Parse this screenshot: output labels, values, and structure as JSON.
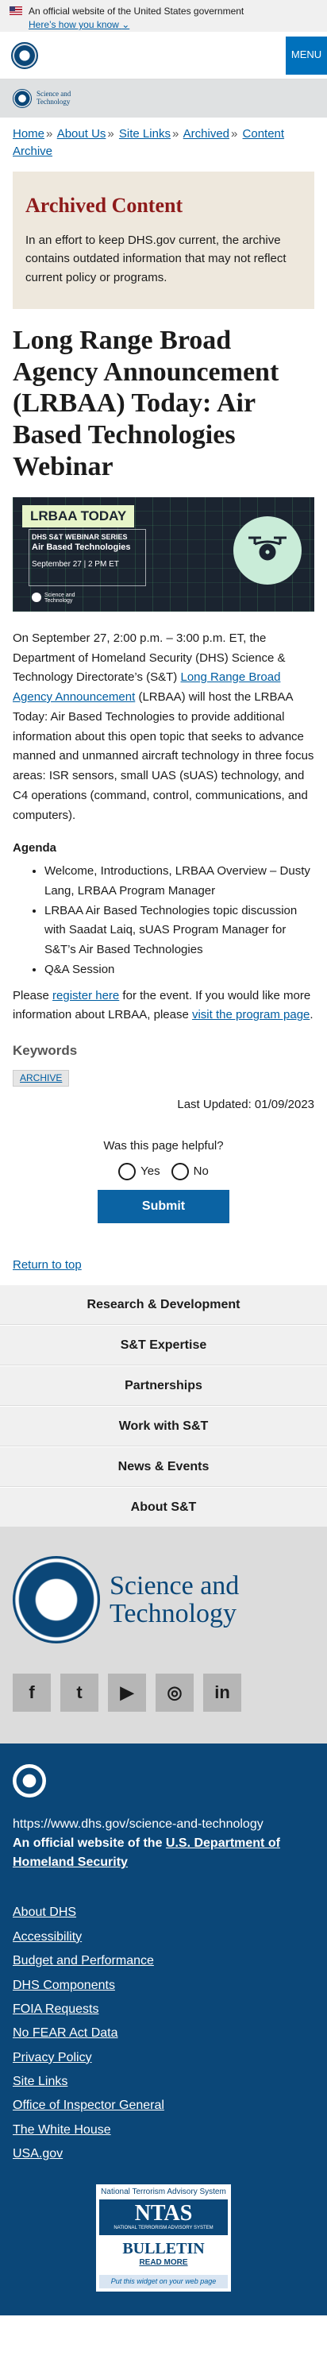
{
  "gov_banner": {
    "text": "An official website of the United States government",
    "how": "Here’s how you know"
  },
  "header": {
    "menu": "MENU"
  },
  "st_bar": {
    "line1": "Science and",
    "line2": "Technology"
  },
  "breadcrumb": [
    "Home",
    "About Us",
    "Site Links",
    "Archived",
    "Content Archive"
  ],
  "archived": {
    "title": "Archived Content",
    "text": "In an effort to keep DHS.gov current, the archive contains outdated information that may not reflect current policy or programs."
  },
  "title": "Long Range Broad Agency Announcement (LRBAA) Today: Air Based Technologies Webinar",
  "hero": {
    "tag": "LRBAA TODAY",
    "series": "DHS S&T WEBINAR SERIES",
    "subject": "Air Based Technologies",
    "date": "September 27  |  2 PM ET",
    "org": "Science and Technology"
  },
  "intro": {
    "part1": "On September 27, 2:00 p.m. – 3:00 p.m. ET, the Department of Homeland Security (DHS) Science & Technology Directorate’s (S&T) ",
    "link": "Long Range Broad Agency Announcement",
    "part2": " (LRBAA) will host the LRBAA Today: Air Based Technologies to provide additional information about this open topic that seeks to advance manned and unmanned aircraft technology in three focus areas: ISR sensors, small UAS (sUAS) technology, and C4 operations (command, control, communications, and computers)."
  },
  "agenda": {
    "heading": "Agenda",
    "items": [
      "Welcome, Introductions, LRBAA Overview – Dusty Lang, LRBAA Program Manager",
      "LRBAA Air Based Technologies topic discussion with Saadat Laiq, sUAS Program Manager for S&T’s Air Based Technologies",
      "Q&A Session"
    ]
  },
  "register": {
    "pre": "Please ",
    "link1": "register here",
    "mid": " for the event. If you would like more information about LRBAA, please ",
    "link2": "visit the program page",
    "post": "."
  },
  "keywords": {
    "heading": "Keywords",
    "badge": "ARCHIVE"
  },
  "updated": "Last Updated: 01/09/2023",
  "helpful": {
    "question": "Was this page helpful?",
    "yes": "Yes",
    "no": "No",
    "submit": "Submit"
  },
  "return_top": "Return to top",
  "footer_nav": [
    "Research & Development",
    "S&T Expertise",
    "Partnerships",
    "Work with S&T",
    "News & Events",
    "About S&T"
  ],
  "st_footer": {
    "line1": "Science and",
    "line2": "Technology"
  },
  "social": [
    {
      "icon": "facebook-icon",
      "glyph": "f"
    },
    {
      "icon": "twitter-icon",
      "glyph": "t"
    },
    {
      "icon": "youtube-icon",
      "glyph": "▶"
    },
    {
      "icon": "instagram-icon",
      "glyph": "◎"
    },
    {
      "icon": "linkedin-icon",
      "glyph": "in"
    }
  ],
  "dhs_footer": {
    "url": "https://www.dhs.gov/science-and-technology",
    "official_pre": "An official website of the ",
    "official_link": "U.S. Department of Homeland Security",
    "links": [
      "About DHS",
      "Accessibility",
      "Budget and Performance",
      "DHS Components",
      "FOIA Requests",
      "No FEAR Act Data",
      "Privacy Policy",
      "Site Links",
      "Office of Inspector General",
      "The White House",
      "USA.gov"
    ]
  },
  "ntas": {
    "top": "National Terrorism Advisory System",
    "big": "NTAS",
    "small": "NATIONAL TERRORISM ADVISORY SYSTEM",
    "bulletin": "BULLETIN",
    "readmore": "READ MORE",
    "widget": "Put this widget on your web page"
  }
}
